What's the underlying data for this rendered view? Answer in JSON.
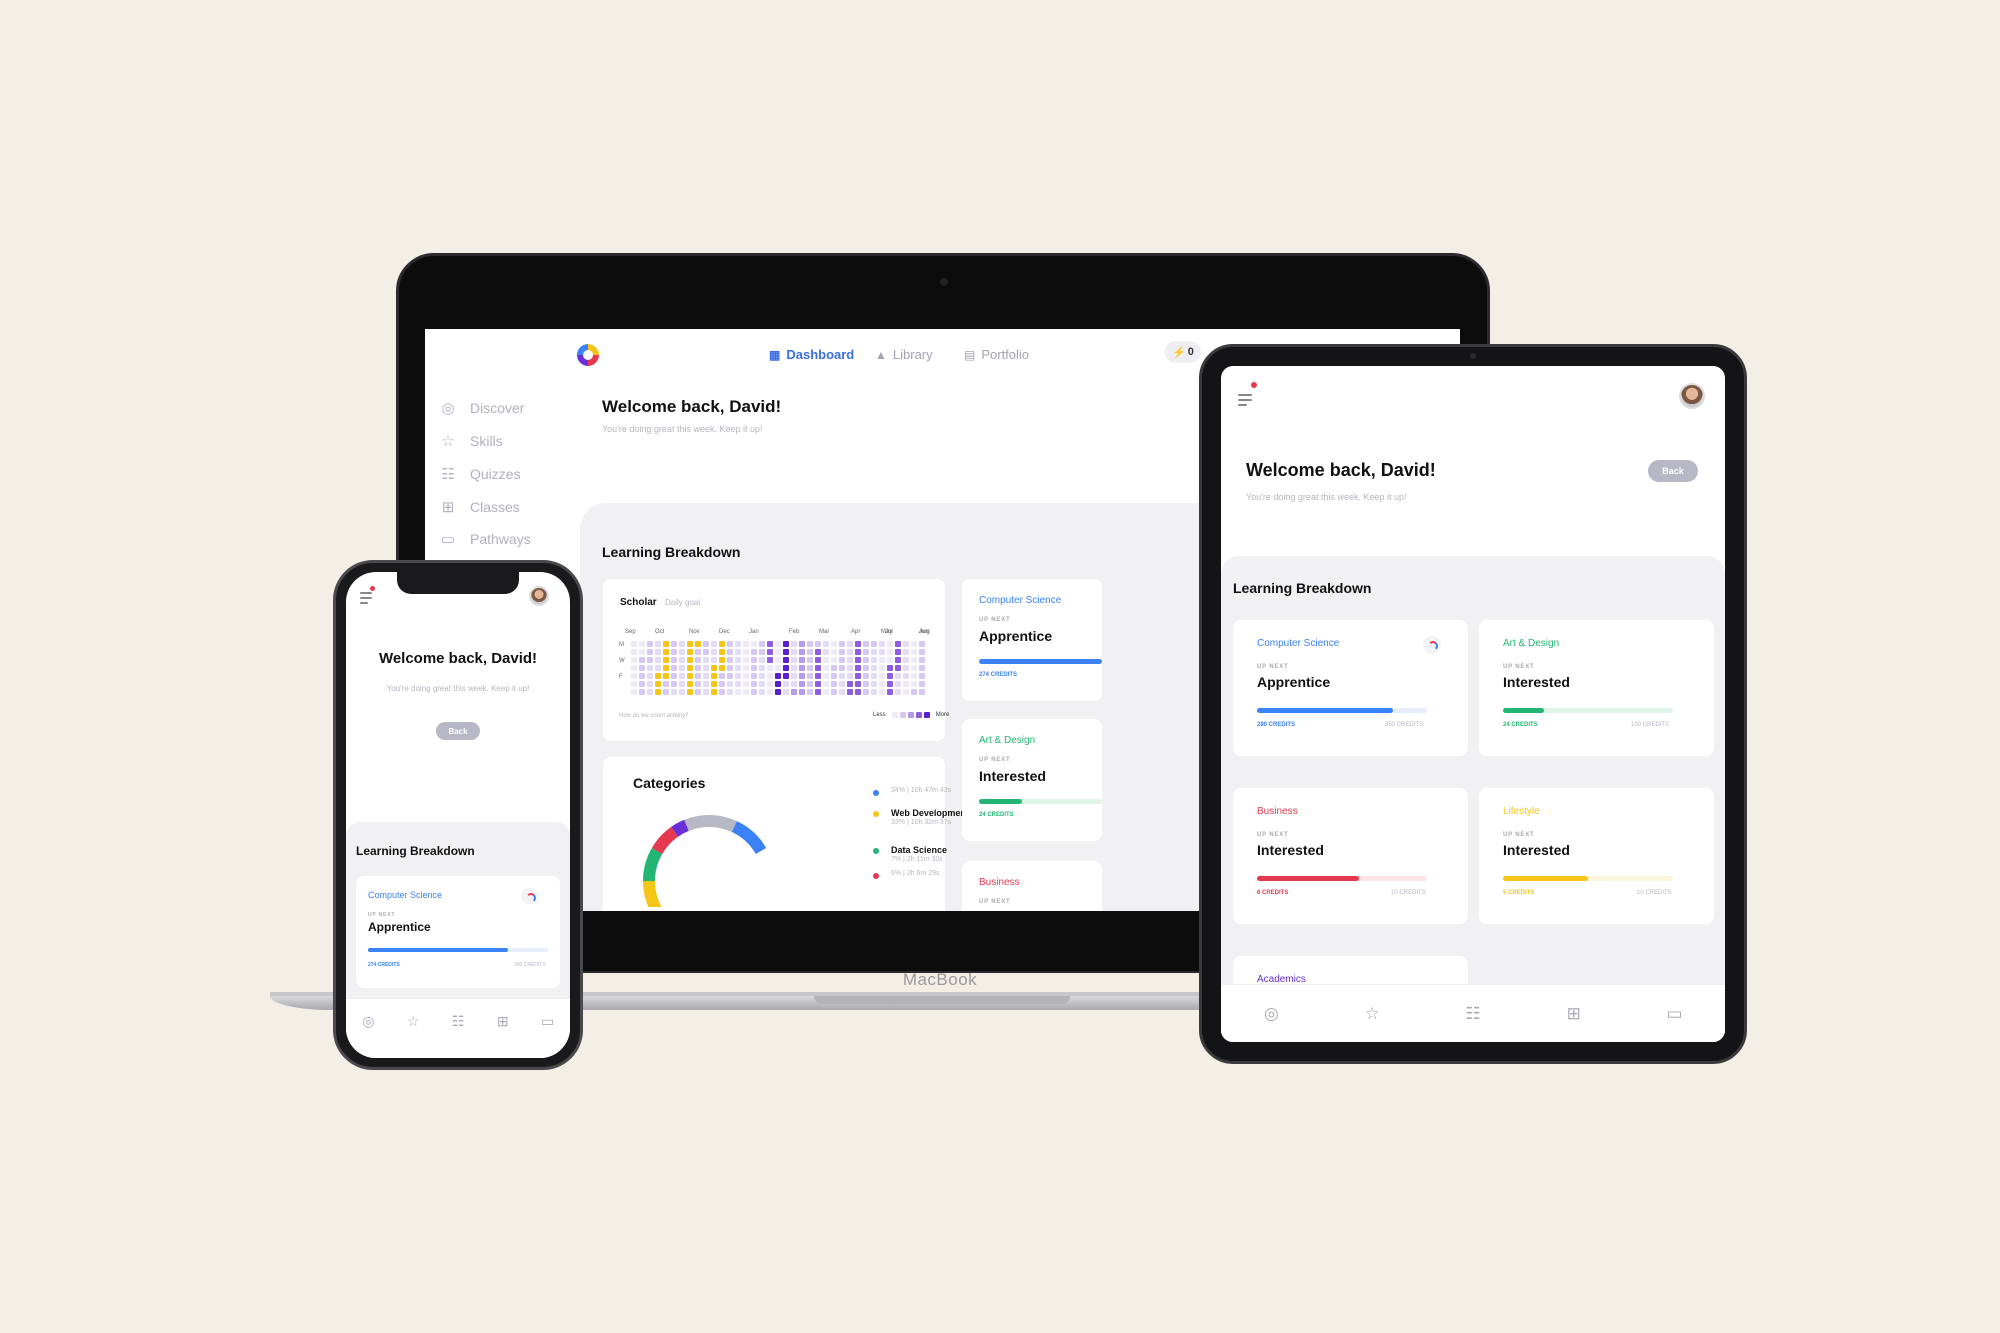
{
  "laptop": {
    "brand": "MacBook",
    "nav": [
      {
        "label": "Dashboard",
        "icon": "dashboard-icon"
      },
      {
        "label": "Library",
        "icon": "library-icon"
      },
      {
        "label": "Portfolio",
        "icon": "portfolio-icon"
      }
    ],
    "bolt_count": "0",
    "sidebar": [
      {
        "label": "Discover",
        "icon": "compass-icon"
      },
      {
        "label": "Skills",
        "icon": "star-icon"
      },
      {
        "label": "Quizzes",
        "icon": "quiz-icon"
      },
      {
        "label": "Classes",
        "icon": "grid-icon"
      },
      {
        "label": "Pathways",
        "icon": "folder-icon"
      }
    ],
    "welcome_title": "Welcome back, David!",
    "welcome_sub": "You're doing great this week. Keep it up!",
    "learning_breakdown": "Learning Breakdown",
    "scholar": {
      "title": "Scholar",
      "goal": "Daily goal",
      "months": [
        "Sep",
        "Oct",
        "Nov",
        "Dec",
        "Jan",
        "Feb",
        "Mar",
        "Apr",
        "May",
        "Jun",
        "Jul",
        "Aug"
      ],
      "days": [
        "M",
        "W",
        "F"
      ],
      "footnote": "How do we count activity?",
      "less": "Less",
      "more": "More"
    },
    "categories": {
      "title": "Categories",
      "items": [
        {
          "name": "",
          "meta": "34% | 10h 47m 43s",
          "color": "#3b82f6"
        },
        {
          "name": "Web Development",
          "meta": "33% | 10h 32m 37s",
          "color": "#f5c518"
        },
        {
          "name": "Data Science",
          "meta": "7% | 2h 11m 30s",
          "color": "#22b573"
        },
        {
          "name": "",
          "meta": "6% | 2h 6m 29s",
          "color": "#e53950"
        }
      ]
    },
    "skill_cards": [
      {
        "category": "Computer Science",
        "up_next": "UP NEXT",
        "level": "Apprentice",
        "credits": "274 CREDITS",
        "color": "#3b82f6"
      },
      {
        "category": "Art & Design",
        "up_next": "UP NEXT",
        "level": "Interested",
        "credits": "24 CREDITS",
        "color": "#22b573"
      },
      {
        "category": "Business",
        "up_next": "UP NEXT",
        "level": "",
        "credits": "",
        "color": "#e53950"
      }
    ]
  },
  "tablet": {
    "welcome_title": "Welcome back, David!",
    "welcome_sub": "You're doing great this week. Keep it up!",
    "back": "Back",
    "learning_breakdown": "Learning Breakdown",
    "cards": [
      {
        "category": "Computer Science",
        "up_next": "UP NEXT",
        "level": "Apprentice",
        "credits": "280 CREDITS",
        "target": "350 CREDITS",
        "color": "#3b82f6",
        "progress": 0.8
      },
      {
        "category": "Art & Design",
        "up_next": "UP NEXT",
        "level": "Interested",
        "credits": "24 CREDITS",
        "target": "100 CREDITS",
        "color": "#22b573",
        "progress": 0.24
      },
      {
        "category": "Business",
        "up_next": "UP NEXT",
        "level": "Interested",
        "credits": "6 CREDITS",
        "target": "10 CREDITS",
        "color": "#e53950",
        "progress": 0.6
      },
      {
        "category": "Lifestyle",
        "up_next": "UP NEXT",
        "level": "Interested",
        "credits": "5 CREDITS",
        "target": "10 CREDITS",
        "color": "#f5c518",
        "progress": 0.5
      }
    ],
    "academics": "Academics"
  },
  "phone": {
    "welcome_title": "Welcome back, David!",
    "welcome_sub": "You're doing great this week. Keep it up!",
    "back": "Back",
    "learning_breakdown": "Learning Breakdown",
    "card": {
      "category": "Computer Science",
      "up_next": "UP NEXT",
      "level": "Apprentice",
      "credits": "274 CREDITS",
      "target": "350 CREDITS",
      "color": "#3b82f6",
      "progress": 0.78
    }
  },
  "tabbar": [
    "compass-icon",
    "star-icon",
    "quiz-icon",
    "grid-icon",
    "folder-icon"
  ]
}
